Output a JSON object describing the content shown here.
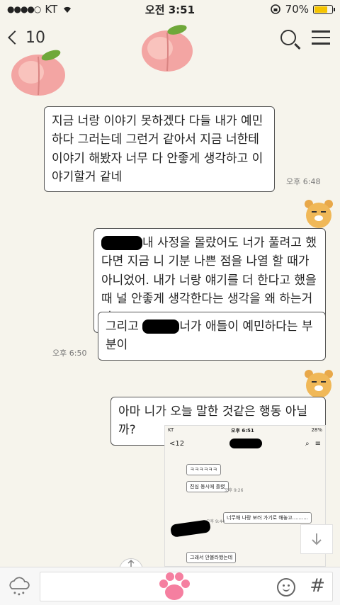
{
  "status_bar": {
    "carrier": "KT",
    "time": "오전 3:51",
    "battery": "70%",
    "battery_level": 0.7
  },
  "header": {
    "unread_count": "10"
  },
  "messages": [
    {
      "side": "left",
      "text": "지금 너랑 이야기 못하겠다 다들 내가 예민하다 그러는데 그런거 같아서 지금 너한테 이야기 해봤자 너무 다 안좋게 생각하고 이야기할거 같네",
      "time": "오후 6:48"
    },
    {
      "side": "right",
      "text_after_redaction": "내 사정을 몰랐어도 너가 풀려고 했다면 지금 니 기분 나쁜 점을 나열 할 때가 아니었어. 내가 너랑 얘기를 더 한다고 했을 때 널 안좋게 생각한다는 생각을 왜 하는거야?"
    },
    {
      "side": "right",
      "text_before": "그리고",
      "text_after": "너가 애들이 예민하다는 부분이",
      "time": "오후 6:50"
    },
    {
      "side": "right",
      "text": "아마 니가 오늘 말한 것같은 행동 아닐까?"
    }
  ],
  "embedded": {
    "carrier": "KT",
    "time": "오후 6:51",
    "battery": "28%",
    "unread": "12",
    "bubbles": [
      "ㅋㅋㅋㅋㅋㅋ",
      "진심 동시에 흘렸",
      "너무해 나랑 보러 가기로 해놓고..........",
      "그래서 안볼라했는데"
    ],
    "times": [
      "오후 9:26",
      "오후 9:44"
    ]
  },
  "colors": {
    "background": "#f6f4ec",
    "bubble_border": "#555555",
    "battery": "#f5c400"
  }
}
